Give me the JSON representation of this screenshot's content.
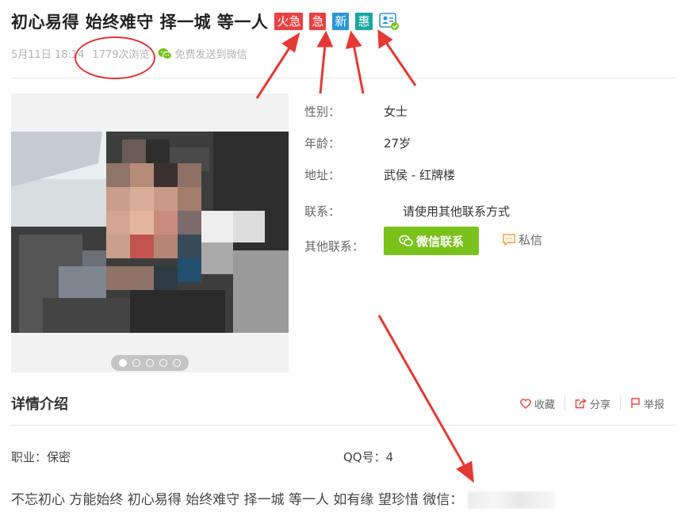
{
  "post": {
    "title": "初心易得 始终难守 择一城 等一人",
    "tags": [
      {
        "label": "火急",
        "color": "#e84142"
      },
      {
        "label": "急",
        "color": "#e84142"
      },
      {
        "label": "新",
        "color": "#2b97d6"
      },
      {
        "label": "惠",
        "color": "#1aa6a3"
      }
    ],
    "cert_icon": "id-card-verified-icon",
    "date": "5月11日 18:14",
    "views": "1779次浏览",
    "share_wechat": "免费发送到微信"
  },
  "gallery": {
    "dot_count": 5,
    "active_index": 0
  },
  "info": {
    "gender_label": "性别：",
    "gender_value": "女士",
    "age_label": "年龄：",
    "age_value": "27岁",
    "address_label": "地址：",
    "address_value": "武侯 - 红牌楼",
    "contact_label": "联系：",
    "contact_value": "请使用其他联系方式",
    "other_contact_label": "其他联系：",
    "wechat_button": "微信联系",
    "message_link": "私信"
  },
  "details": {
    "section_title": "详情介绍",
    "favorite": "收藏",
    "share": "分享",
    "report": "举报",
    "occupation": "职业：保密",
    "qq": "QQ号：4",
    "description": "不忘初心 方能始终 初心易得 始终难守 择一城 等一人 如有缘 望珍惜 微信："
  },
  "colors": {
    "accent_green": "#7ac21b",
    "annotation_red": "#d9383a",
    "message_orange": "#f0a030"
  }
}
